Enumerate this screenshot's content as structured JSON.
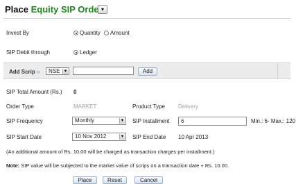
{
  "header": {
    "title_prefix": "Place",
    "title_highlight": "Equity SIP Order",
    "dropdown_glyph": "▾"
  },
  "invest_by": {
    "label": "Invest By",
    "options": [
      {
        "label": "Quantity",
        "selected": true
      },
      {
        "label": "Amount",
        "selected": false
      }
    ]
  },
  "sip_debit": {
    "label": "SIP Debit through",
    "option": "Ledger",
    "selected": true
  },
  "add_scrip": {
    "label": "Add Scrip",
    "arrow": "»",
    "exchange": "NSE",
    "scrip_value": "",
    "add_button": "Add"
  },
  "summary": {
    "total_label": "SIP Total Amount (Rs.)",
    "total_value": "0",
    "order_type_label": "Order Type",
    "order_type_value": "MARKET",
    "product_type_label": "Product Type",
    "product_type_value": "Delivery"
  },
  "frequency": {
    "label": "SIP Frequency",
    "value": "Monthly",
    "installment_label": "SIP Installment",
    "installment_value": "6",
    "range_text": "Min.: 6- Max.: 120"
  },
  "dates": {
    "start_label": "SIP Start Date",
    "start_value": "10 Nov 2012",
    "end_label": "SIP End Date",
    "end_value": "10 Apr 2013"
  },
  "notes": {
    "charges": "(An additional amount of Rs. 10.00 will be charged as transaction charges per installment.)",
    "note_label": "Note:",
    "note_text": " SIP value will be subjected to the market value of scrips on a transaction date + Rs. 10.00."
  },
  "buttons": {
    "place": "Place",
    "reset": "Reset",
    "cancel": "Cancel"
  },
  "icons": {
    "dropdown": "chevron-down-icon",
    "radio": "radio-icon"
  },
  "colors": {
    "title_green": "#1a8a1a",
    "muted_text": "#a0a0a0",
    "bar_bg": "#ececec"
  }
}
